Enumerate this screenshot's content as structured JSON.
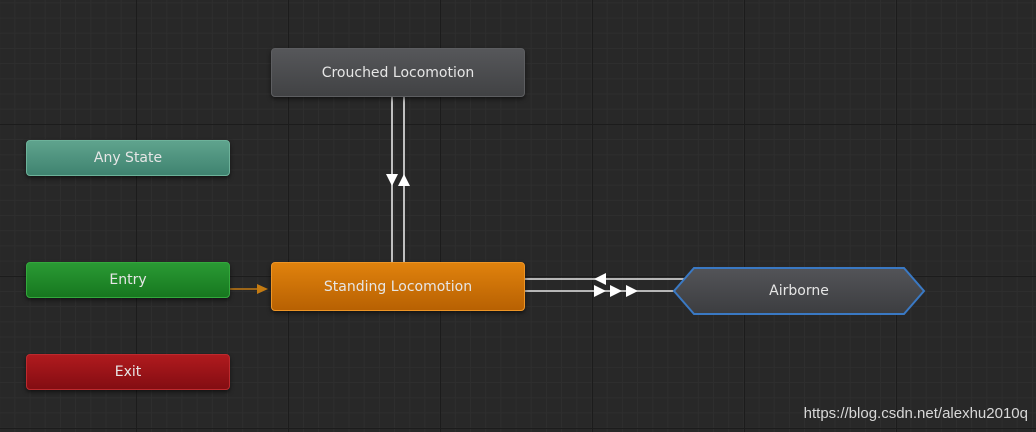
{
  "states": {
    "crouched": "Crouched Locomotion",
    "any_state": "Any State",
    "entry": "Entry",
    "standing": "Standing Locomotion",
    "exit": "Exit",
    "airborne": "Airborne"
  },
  "colors": {
    "background": "#282828",
    "crouched": "#4a4b4e",
    "any_state": "#4e937d",
    "entry": "#1f882a",
    "standing": "#cc7108",
    "exit": "#991318",
    "airborne": "#45464a",
    "airborne_outline": "#3a79c4",
    "transition": "#e6e6e6",
    "entry_transition": "#c47b12"
  },
  "transitions": [
    {
      "from": "Entry",
      "to": "Standing Locomotion"
    },
    {
      "from": "Standing Locomotion",
      "to": "Crouched Locomotion"
    },
    {
      "from": "Crouched Locomotion",
      "to": "Standing Locomotion"
    },
    {
      "from": "Standing Locomotion",
      "to": "Airborne"
    },
    {
      "from": "Airborne",
      "to": "Standing Locomotion"
    }
  ],
  "watermark": "https://blog.csdn.net/alexhu2010q"
}
